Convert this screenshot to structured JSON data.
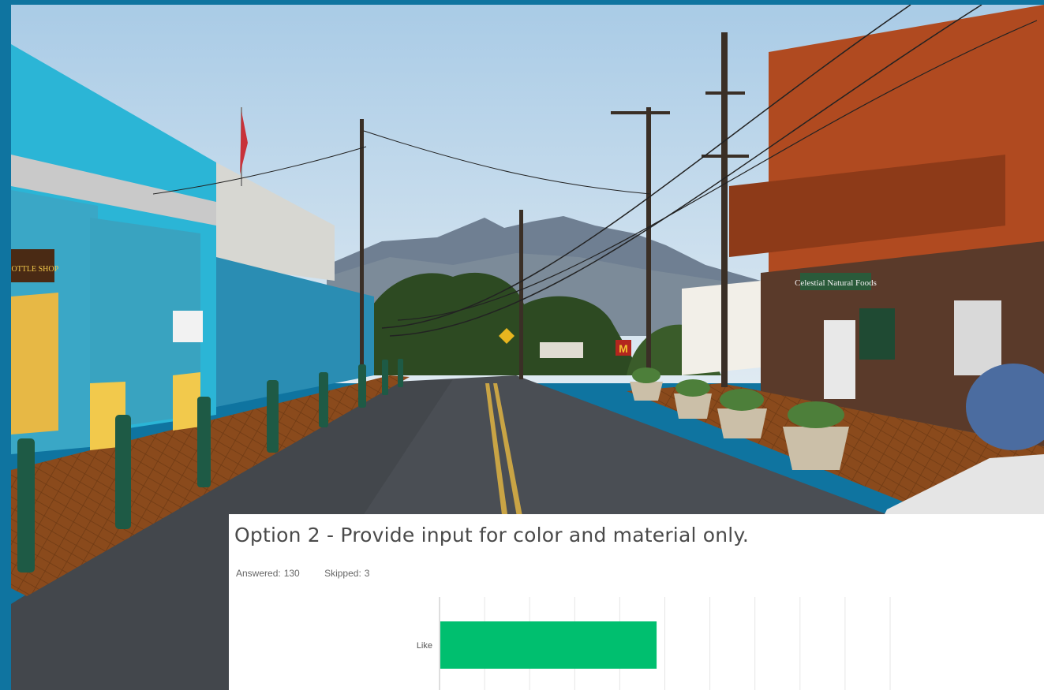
{
  "question": {
    "title": "Option 2 - Provide input for color and material only.",
    "answered_label": "Answered:",
    "answered": "130",
    "skipped_label": "Skipped:",
    "skipped": "3"
  },
  "chart_data": {
    "type": "bar",
    "orientation": "horizontal",
    "categories": [
      "Like"
    ],
    "values": [
      48
    ],
    "xlim": [
      0,
      100
    ],
    "grid": true,
    "bar_color": "#00bf6f"
  },
  "photo": {
    "sign_store": "Celestial Natural Foods",
    "sign_left": "BOTTLE SHOP",
    "sign_mcd": "M"
  },
  "colors": {
    "frame": "#0f74a0",
    "bar": "#00bf6f",
    "grid": "#e6e6e6"
  }
}
